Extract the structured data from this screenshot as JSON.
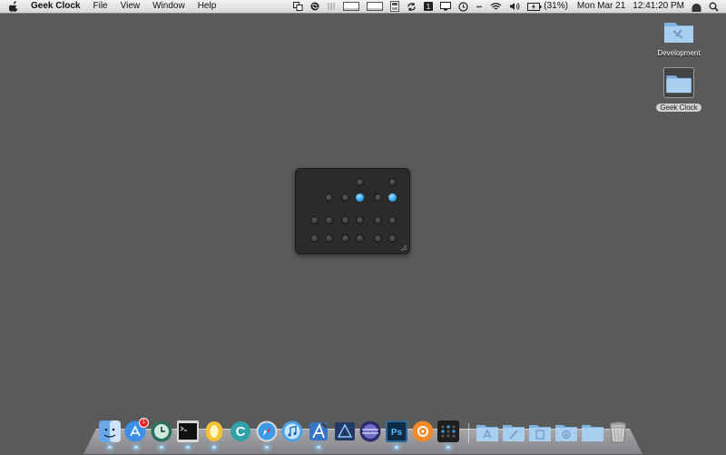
{
  "menubar": {
    "app_name": "Geek Clock",
    "menus": [
      "File",
      "View",
      "Window",
      "Help"
    ],
    "battery_text": "(31%)",
    "date": "Mon Mar 21",
    "time": "12:41:20 PM"
  },
  "desktop": {
    "icons": [
      {
        "label": "Development"
      },
      {
        "label": "Geek Clock"
      }
    ]
  },
  "clock": {
    "columns": [
      {
        "on": [
          false,
          false
        ]
      },
      {
        "on": [
          false,
          false,
          false
        ]
      },
      {
        "on": [
          false,
          false,
          false
        ]
      },
      {
        "on": [
          false,
          true,
          false,
          false
        ]
      },
      {
        "on": [
          false,
          false,
          false
        ]
      },
      {
        "on": [
          false,
          true,
          false,
          false
        ]
      }
    ],
    "colors": {
      "on": "#35a7ee",
      "off": "#3a3a3a"
    }
  },
  "dock": {
    "apps": [
      "Finder",
      "App Store",
      "Time Machine",
      "Terminal",
      "Notes",
      "Dictionary",
      "Safari",
      "iTunes",
      "Xcode",
      "Instruments",
      "Eclipse",
      "Photoshop",
      "Instacast",
      "Geek Clock"
    ],
    "folders": [
      "Applications",
      "Documents",
      "Downloads",
      "Desktop",
      "Pictures"
    ],
    "app_store_badge": "1"
  }
}
